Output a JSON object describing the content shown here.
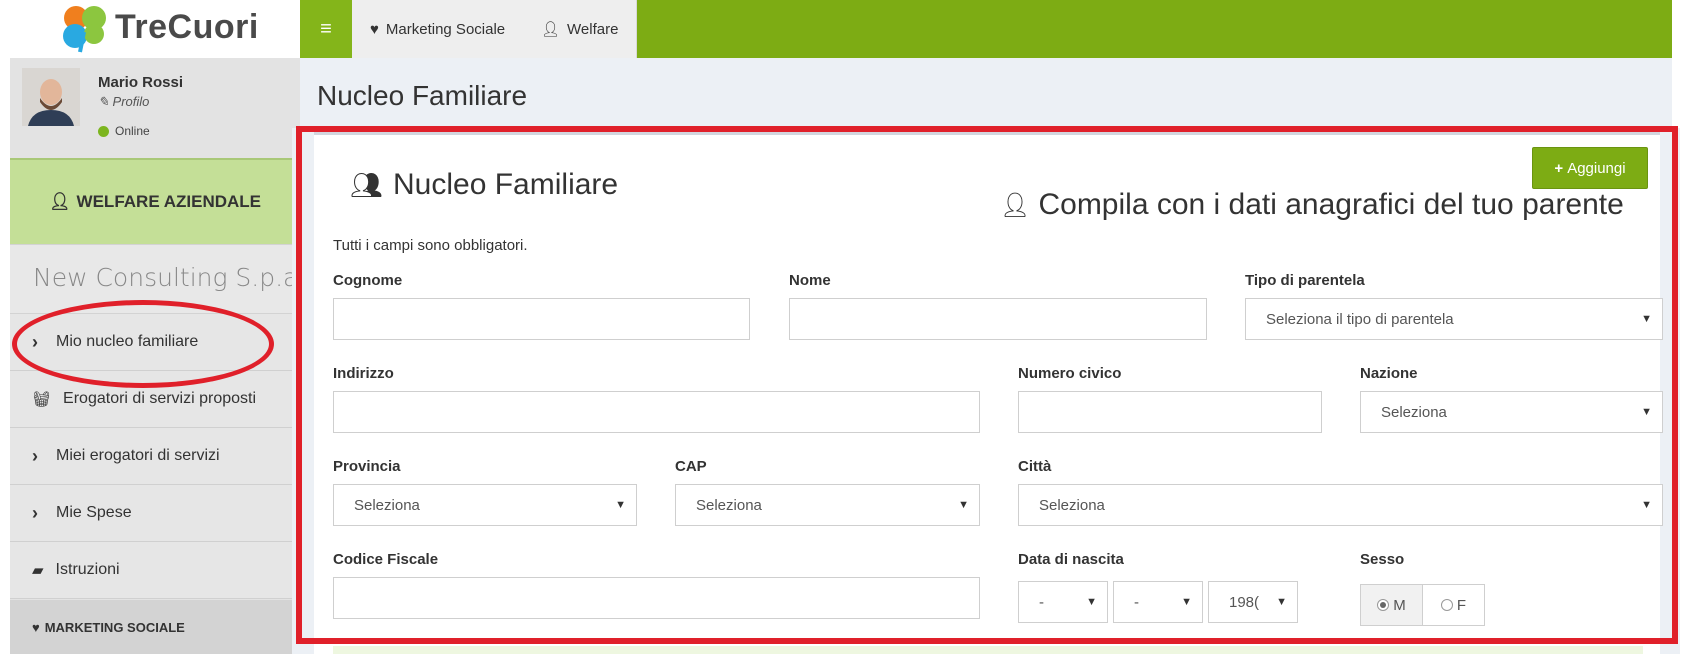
{
  "app": {
    "logo_text": "TreCuori"
  },
  "user": {
    "name": "Mario Rossi",
    "profile_label": "Profilo",
    "status": "Online"
  },
  "sidebar": {
    "welfare_label": "WELFARE AZIENDALE",
    "company": "New Consulting S.p.a",
    "items": [
      {
        "label": "Mio nucleo familiare",
        "icon": "chevron-right-icon"
      },
      {
        "label": "Erogatori di servizi proposti",
        "icon": "basket-icon"
      },
      {
        "label": "Miei erogatori di servizi",
        "icon": "chevron-right-icon"
      },
      {
        "label": "Mie Spese",
        "icon": "chevron-right-icon"
      },
      {
        "label": "Istruzioni",
        "icon": "book-icon"
      }
    ],
    "marketing_label": "MARKETING SOCIALE"
  },
  "topbar": {
    "tabs": [
      {
        "label": "Marketing Sociale",
        "icon": "heart-icon"
      },
      {
        "label": "Welfare",
        "icon": "user-icon"
      }
    ]
  },
  "page": {
    "title": "Nucleo Familiare"
  },
  "form": {
    "box_title": "Nucleo Familiare",
    "box_subtitle": "Compila con i dati anagrafici del tuo parente",
    "add_label": "Aggiungi",
    "required_note": "Tutti i campi sono obbligatori.",
    "labels": {
      "cognome": "Cognome",
      "nome": "Nome",
      "tipo_parentela": "Tipo di parentela",
      "indirizzo": "Indirizzo",
      "numero_civico": "Numero civico",
      "nazione": "Nazione",
      "provincia": "Provincia",
      "cap": "CAP",
      "citta": "Città",
      "codice_fiscale": "Codice Fiscale",
      "data_nascita": "Data di nascita",
      "sesso": "Sesso"
    },
    "selects": {
      "tipo_parentela": "Seleziona il tipo di parentela",
      "nazione": "Seleziona",
      "provincia": "Seleziona",
      "cap": "Seleziona",
      "citta": "Seleziona",
      "giorno": "-",
      "mese": "-",
      "anno": "198("
    },
    "sex_options": {
      "m": "M",
      "f": "F",
      "selected": "M"
    }
  },
  "colors": {
    "brand_green": "#7dac14",
    "highlight_red": "#e0202a",
    "welfare_box": "#c4df97"
  }
}
